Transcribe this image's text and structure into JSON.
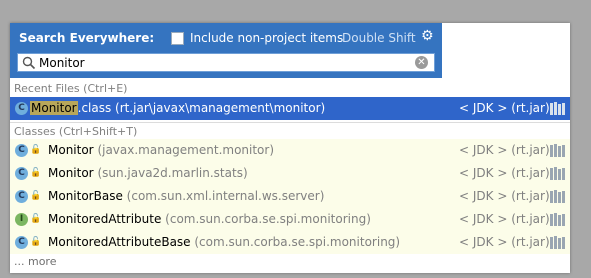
{
  "header": {
    "title": "Search Everywhere:",
    "checkbox_label": "Include non-project items",
    "shortcut": "Double Shift",
    "gear_icon": "gear-icon"
  },
  "search": {
    "value": "Monitor",
    "placeholder": ""
  },
  "sections": [
    {
      "label": "Recent Files (Ctrl+E)",
      "items": [
        {
          "match": "Monitor",
          "name_rest": ".class",
          "pkg": " (rt.jar\\javax\\management\\monitor)",
          "location": "< JDK > (rt.jar)",
          "icon": "class-icon",
          "selected": true
        }
      ]
    },
    {
      "label": "Classes (Ctrl+Shift+T)",
      "items": [
        {
          "name": "Monitor",
          "pkg": " (javax.management.monitor)",
          "location": "< JDK > (rt.jar)",
          "icon": "class-icon"
        },
        {
          "name": "Monitor",
          "pkg": " (sun.java2d.marlin.stats)",
          "location": "< JDK > (rt.jar)",
          "icon": "class-icon"
        },
        {
          "name": "MonitorBase",
          "pkg": " (com.sun.xml.internal.ws.server)",
          "location": "< JDK > (rt.jar)",
          "icon": "class-icon"
        },
        {
          "name": "MonitoredAttribute",
          "pkg": " (com.sun.corba.se.spi.monitoring)",
          "location": "< JDK > (rt.jar)",
          "icon": "interface-icon"
        },
        {
          "name": "MonitoredAttributeBase",
          "pkg": " (com.sun.corba.se.spi.monitoring)",
          "location": "< JDK > (rt.jar)",
          "icon": "class-icon"
        }
      ]
    }
  ],
  "more_label": "... more",
  "colors": {
    "header_bg": "#3574c0",
    "selected_bg": "#2f65ca",
    "match_highlight": "#b8a75a",
    "row_bg": "#fcfde9"
  }
}
